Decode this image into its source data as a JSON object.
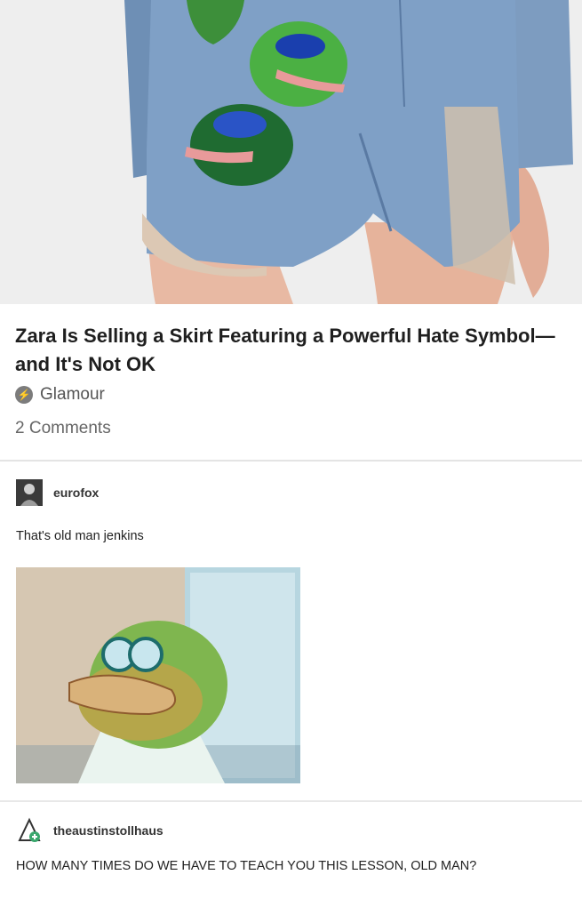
{
  "article": {
    "headline": "Zara Is Selling a Skirt Featuring a Powerful Hate Symbol—and It's Not OK",
    "source": "Glamour",
    "comments": "2 Comments",
    "source_icon": "lightning-bolt-icon"
  },
  "posts": [
    {
      "username": "eurofox",
      "text": "That's old man jenkins"
    },
    {
      "username": "theaustinstollhaus",
      "text": "HOW MANY TIMES DO WE HAVE TO TEACH YOU THIS LESSON, OLD MAN?"
    }
  ]
}
